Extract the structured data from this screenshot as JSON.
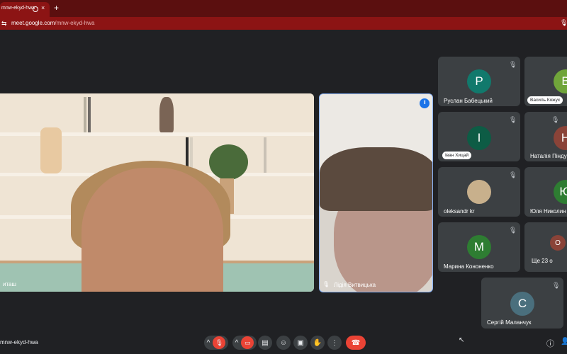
{
  "browser": {
    "tab_title": "mnw-ekyd-hwa",
    "tab_close": "×",
    "new_tab": "+",
    "url_host": "meet.google.com",
    "url_path": "/mnw-ekyd-hwa"
  },
  "main_video": {
    "name": "иташ"
  },
  "second_video": {
    "name": "Лідія Витвицька"
  },
  "participants": [
    {
      "name": "Руслан Бабецький",
      "initial": "Р",
      "color": "#11796c"
    },
    {
      "name": "Василь Кожух",
      "initial": "В",
      "color": "#70a53a"
    },
    {
      "name": "Іван Хицай",
      "initial": "І",
      "color": "#0d5c45"
    },
    {
      "name": "Наталія Піндус",
      "initial": "Н",
      "color": "#8a4338"
    },
    {
      "name": "oleksandr kr",
      "initial": ""
    },
    {
      "name": "Юля Николин",
      "initial": "Ю",
      "color": "#2e7d32"
    },
    {
      "name": "Марина Кононенко",
      "initial": "М",
      "color": "#2e7d32"
    },
    {
      "name": "Ще 23 о",
      "initial": "О"
    },
    {
      "name": "Сергій Маланчук",
      "initial": "С",
      "color": "#4a6f7d"
    }
  ],
  "bottom_bar": {
    "meeting_code": "mnw-ekyd-hwa",
    "chevron": "^",
    "more": "⋮",
    "info": "ⓘ"
  }
}
